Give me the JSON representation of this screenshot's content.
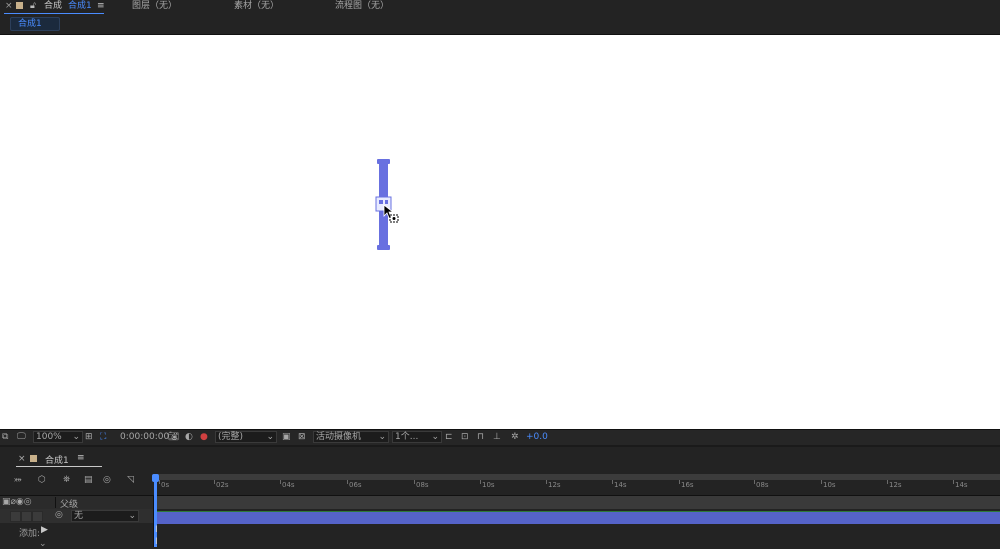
{
  "top_tabs": {
    "close_glyph": "×",
    "comp_panel_title": "合成",
    "comp_name": "合成1",
    "menu_glyph": "≡",
    "layer_panel": "图层（无）",
    "footage_panel": "素材（无）",
    "flowchart_panel": "流程图（无）"
  },
  "comp_subtab": "合成1",
  "viewer_toolbar": {
    "zoom": "100%",
    "timecode": "0:00:00:00",
    "resolution": "(完整)",
    "camera": "活动摄像机",
    "views": "1个...",
    "exposure": "+0.0"
  },
  "timeline": {
    "close_glyph": "×",
    "comp_name": "合成1",
    "menu_glyph": "≡",
    "ruler_ticks": [
      "0s",
      "02s",
      "04s",
      "06s",
      "08s",
      "10s",
      "12s",
      "14s",
      "16s",
      "08s",
      "10s",
      "12s",
      "14s"
    ],
    "parent_header": "父级",
    "parent_value": "无",
    "add_label": "添加:"
  },
  "colors": {
    "accent": "#4a8cff",
    "layer_bar": "#5563c9",
    "guide_handle": "#6870e0"
  }
}
